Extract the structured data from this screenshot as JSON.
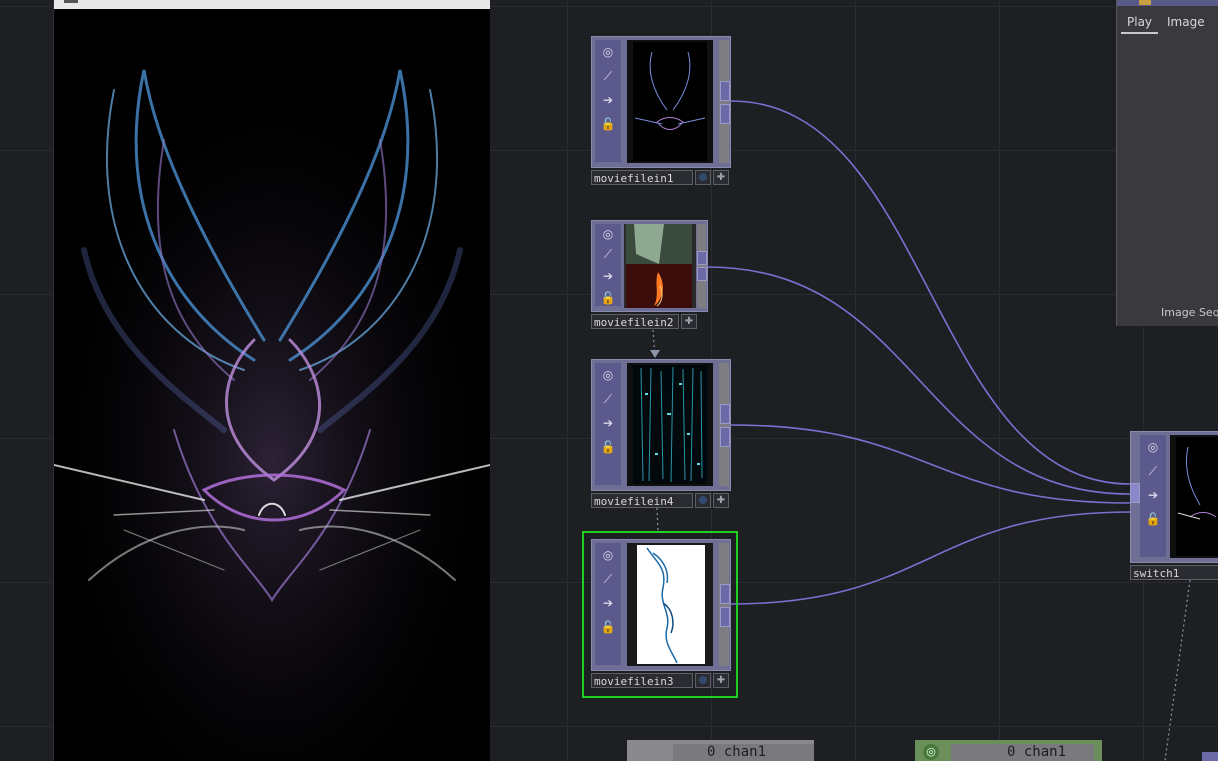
{
  "nodes": {
    "moviefilein1": {
      "name": "moviefilein1"
    },
    "moviefilein2": {
      "name": "moviefilein2"
    },
    "moviefilein4": {
      "name": "moviefilein4"
    },
    "moviefilein3": {
      "name": "moviefilein3"
    },
    "switch1": {
      "name": "switch1"
    }
  },
  "panel": {
    "tabs": [
      "Play",
      "Image"
    ],
    "footer": "Image Seq"
  },
  "chops": {
    "left": "0 chan1",
    "right": "0 chan1"
  },
  "icons": [
    "viewer-toggle-icon",
    "cook-icon",
    "bypass-arrow-icon",
    "lock-icon",
    "plus-icon"
  ],
  "colors": {
    "wire": "#7b6fd0",
    "node": "#6f6e94",
    "selected": "#22d022",
    "background": "#1e1f23"
  }
}
